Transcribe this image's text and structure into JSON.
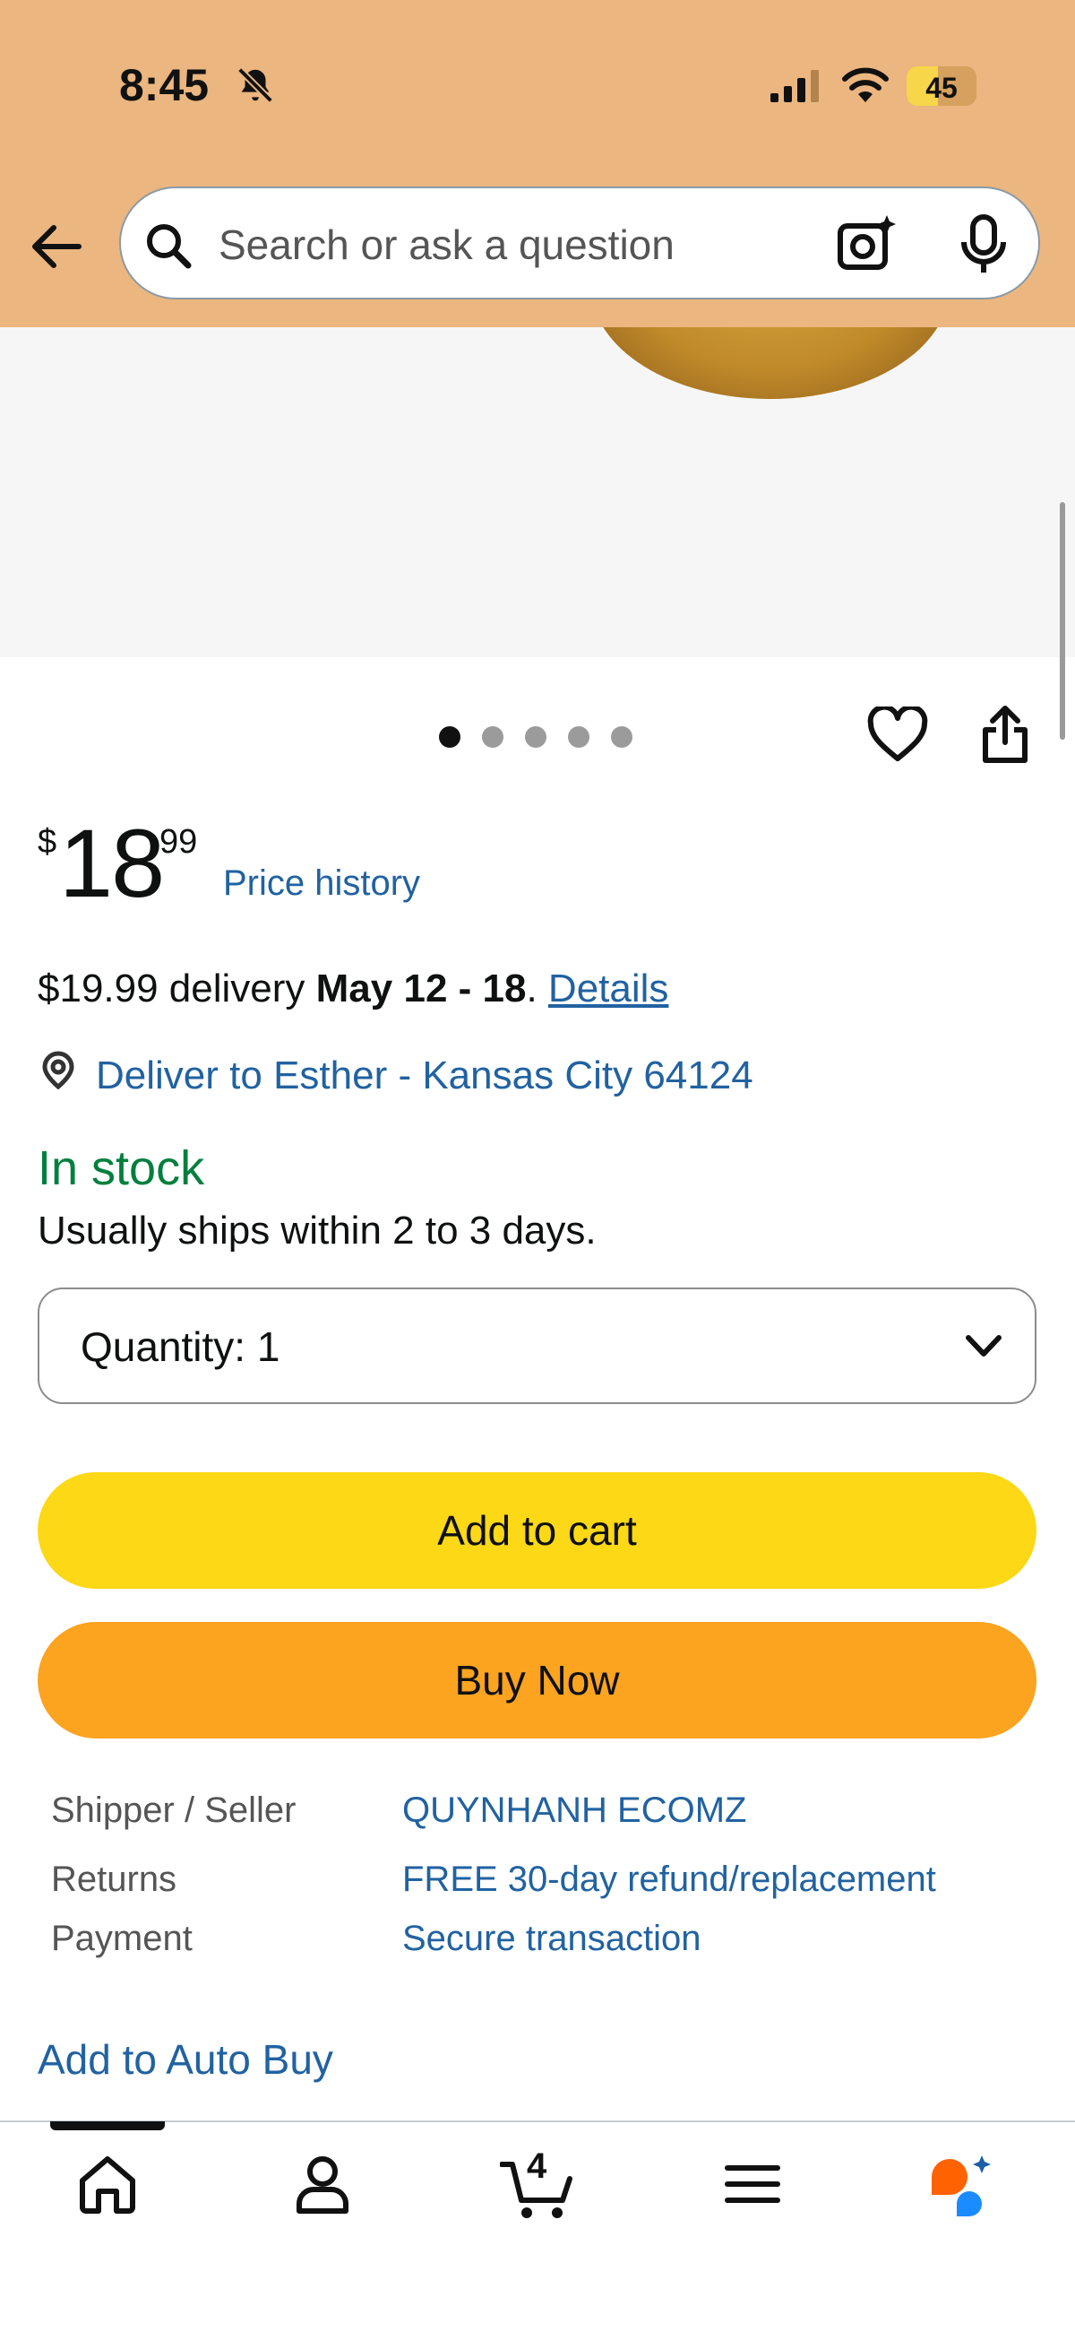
{
  "status_bar": {
    "time": "8:45",
    "battery_level": "45",
    "battery_fraction": 0.45,
    "icons": [
      "bell-slash-icon",
      "cellular-signal-icon",
      "wifi-icon",
      "battery-icon"
    ]
  },
  "header": {
    "search_placeholder": "Search or ask a question",
    "icons": [
      "back-arrow-icon",
      "search-icon",
      "camera-lens-icon",
      "microphone-icon"
    ]
  },
  "gallery": {
    "image_count": 5,
    "active_index": 0
  },
  "product": {
    "price_symbol": "$",
    "price_whole": "18",
    "price_fraction": "99",
    "price_history_label": "Price history",
    "delivery_cost": "$19.99 delivery",
    "delivery_dates": "May 12 - 18",
    "delivery_details_link": "Details",
    "deliver_to": "Deliver to Esther - Kansas City 64124",
    "stock_status": "In stock",
    "ships_within": "Usually ships within 2 to 3 days.",
    "quantity_label": "Quantity:",
    "quantity_value": "1"
  },
  "actions": {
    "add_to_cart": "Add to cart",
    "buy_now": "Buy Now"
  },
  "info": {
    "rows": [
      {
        "label": "Shipper / Seller",
        "value": "QUYNHANH ECOMZ"
      },
      {
        "label": "Returns",
        "value": "FREE 30-day refund/replacement"
      },
      {
        "label": "Payment",
        "value": "Secure transaction"
      }
    ],
    "auto_buy": "Add to Auto Buy"
  },
  "bottom_nav": {
    "items": [
      "home-icon",
      "account-icon",
      "cart-icon",
      "menu-icon",
      "rufus-assistant-icon"
    ],
    "cart_count": "4"
  },
  "colors": {
    "header_bg": "#ebb67f",
    "link": "#2162a1",
    "in_stock": "#007f3d",
    "add_to_cart": "#fcd816",
    "buy_now": "#fca31f"
  }
}
